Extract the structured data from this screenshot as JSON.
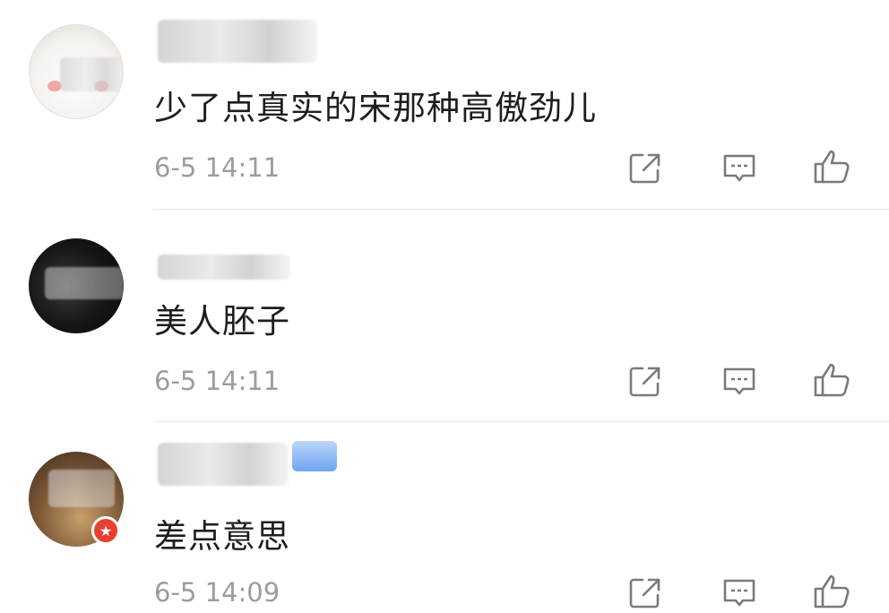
{
  "comments": [
    {
      "avatar_icon": "cute-face-avatar",
      "text": "少了点真实的宋那种高傲劲儿",
      "time": "6-5 14:11"
    },
    {
      "avatar_icon": "dark-portrait-avatar",
      "text": "美人胚子",
      "time": "6-5 14:11"
    },
    {
      "avatar_icon": "cat-avatar",
      "text": "差点意思",
      "time": "6-5 14:09",
      "badge_icon": "star-badge-icon"
    }
  ],
  "actions": {
    "share_icon": "share-icon",
    "comment_icon": "comment-icon",
    "like_icon": "thumbs-up-icon"
  },
  "colors": {
    "text": "#1e1e1e",
    "time": "#9c9c9c",
    "icon": "#7a7a7a",
    "divider": "#e6e6e6",
    "badge_red": "#e8402f",
    "tag_blue": "#6fa5f2"
  }
}
